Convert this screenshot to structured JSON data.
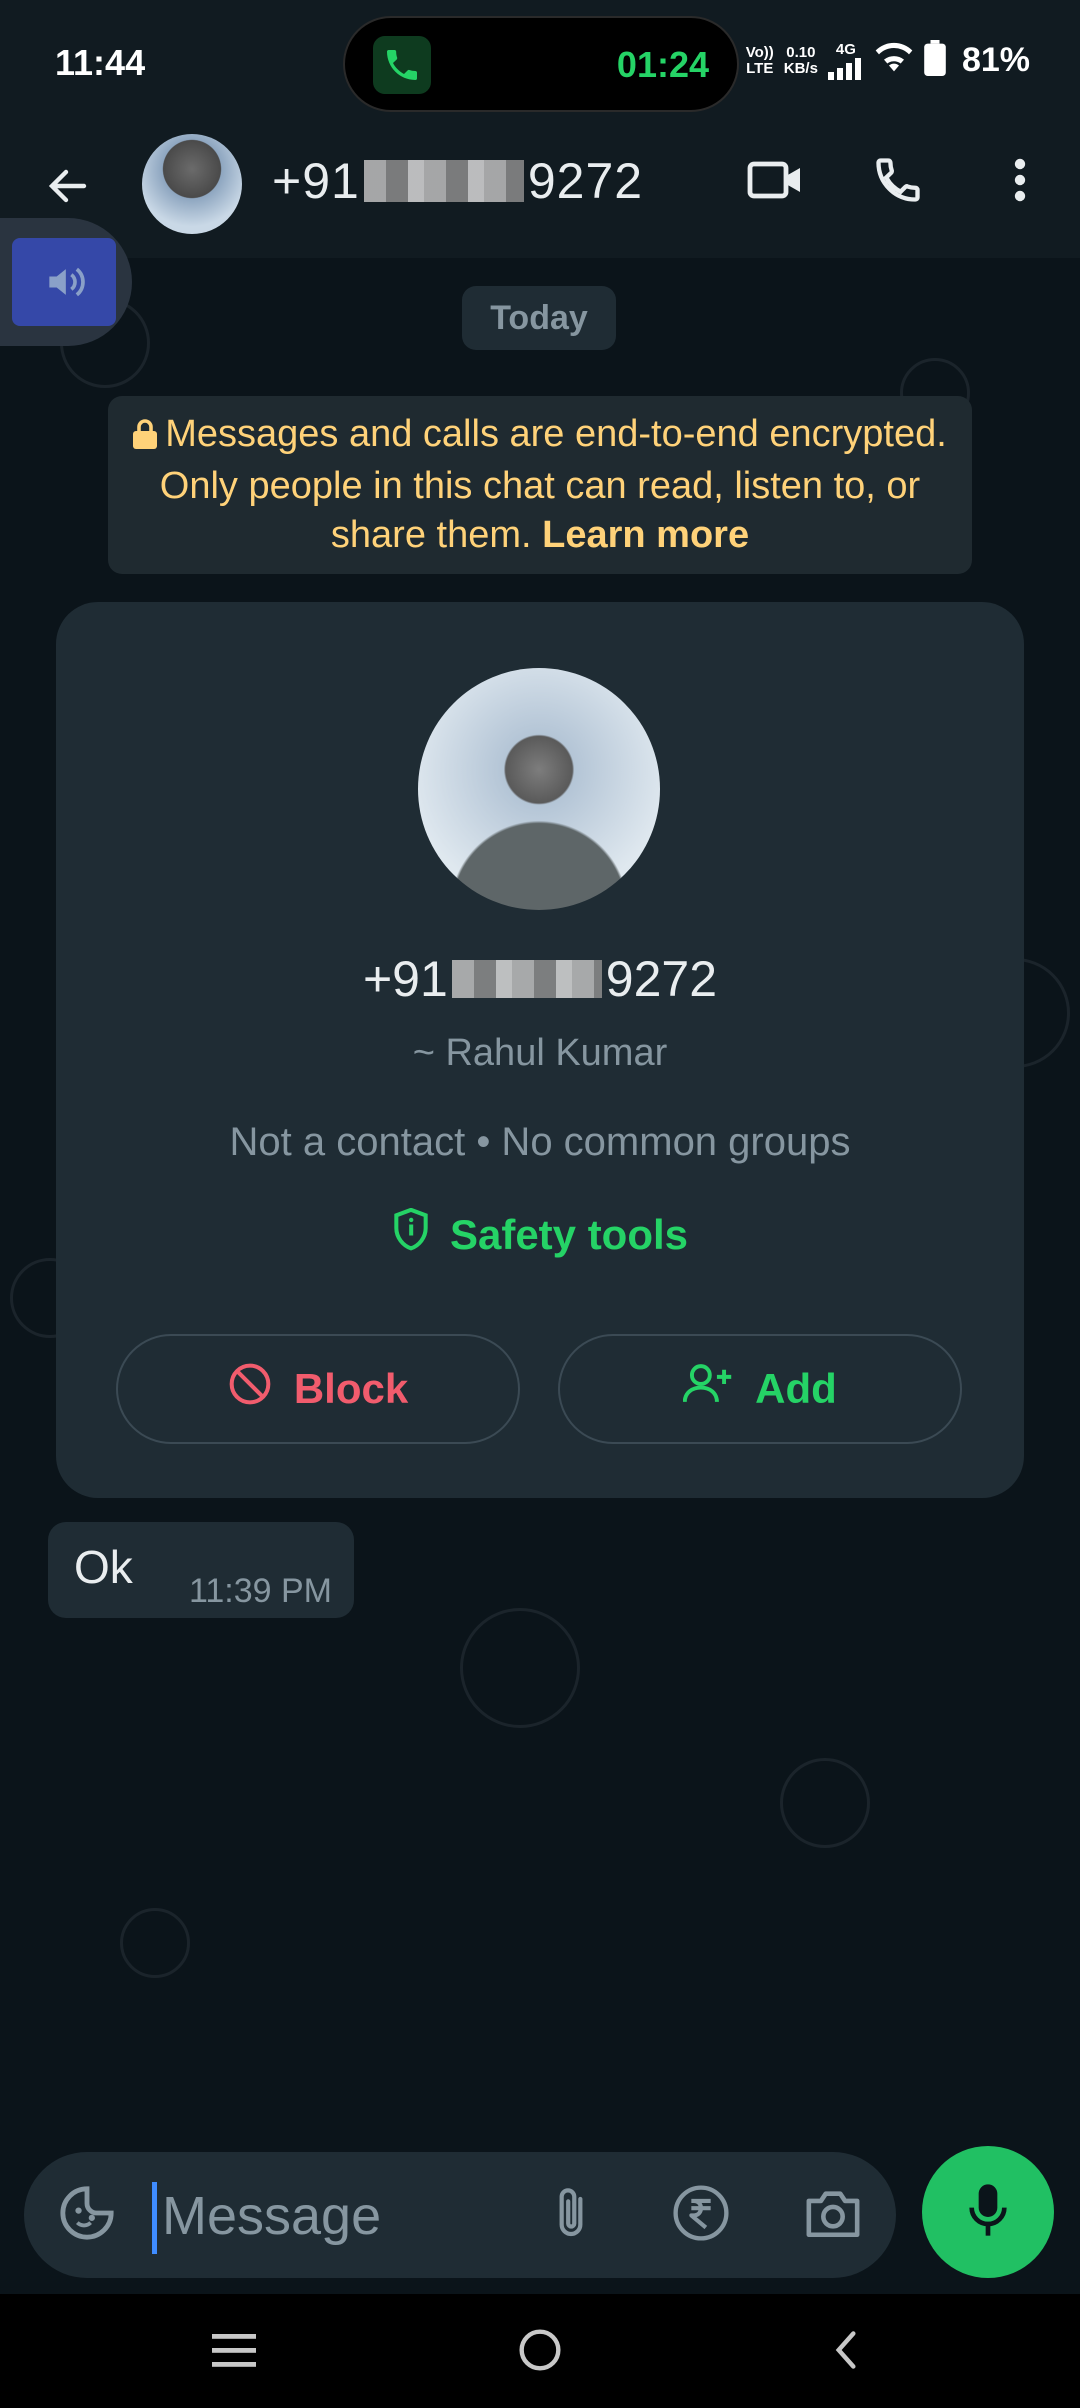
{
  "status_bar": {
    "time": "11:44",
    "call_timer": "01:24",
    "network_volte": "Vo))",
    "network_lte": "LTE",
    "speed_value": "0.10",
    "speed_unit": "KB/s",
    "network_gen": "4G",
    "battery": "81%"
  },
  "header": {
    "title_prefix": "+91",
    "title_suffix": "9272"
  },
  "chat": {
    "date_chip": "Today",
    "encryption_text": "Messages and calls are end-to-end encrypted. Only people in this chat can read, listen to, or share them.",
    "learn_more": "Learn more",
    "contact_card": {
      "phone_prefix": "+91",
      "phone_suffix": "9272",
      "name": "~ Rahul Kumar",
      "subtitle": "Not a contact • No common groups",
      "safety_tools": "Safety tools",
      "block_label": "Block",
      "add_label": "Add"
    },
    "messages": [
      {
        "text": "Ok",
        "time": "11:39 PM"
      }
    ]
  },
  "input_bar": {
    "placeholder": "Message"
  },
  "colors": {
    "accent_green": "#25d366",
    "danger_red": "#f15c6d",
    "notice_yellow": "#ffd279",
    "background": "#0b141a",
    "surface": "#1f2c34"
  }
}
